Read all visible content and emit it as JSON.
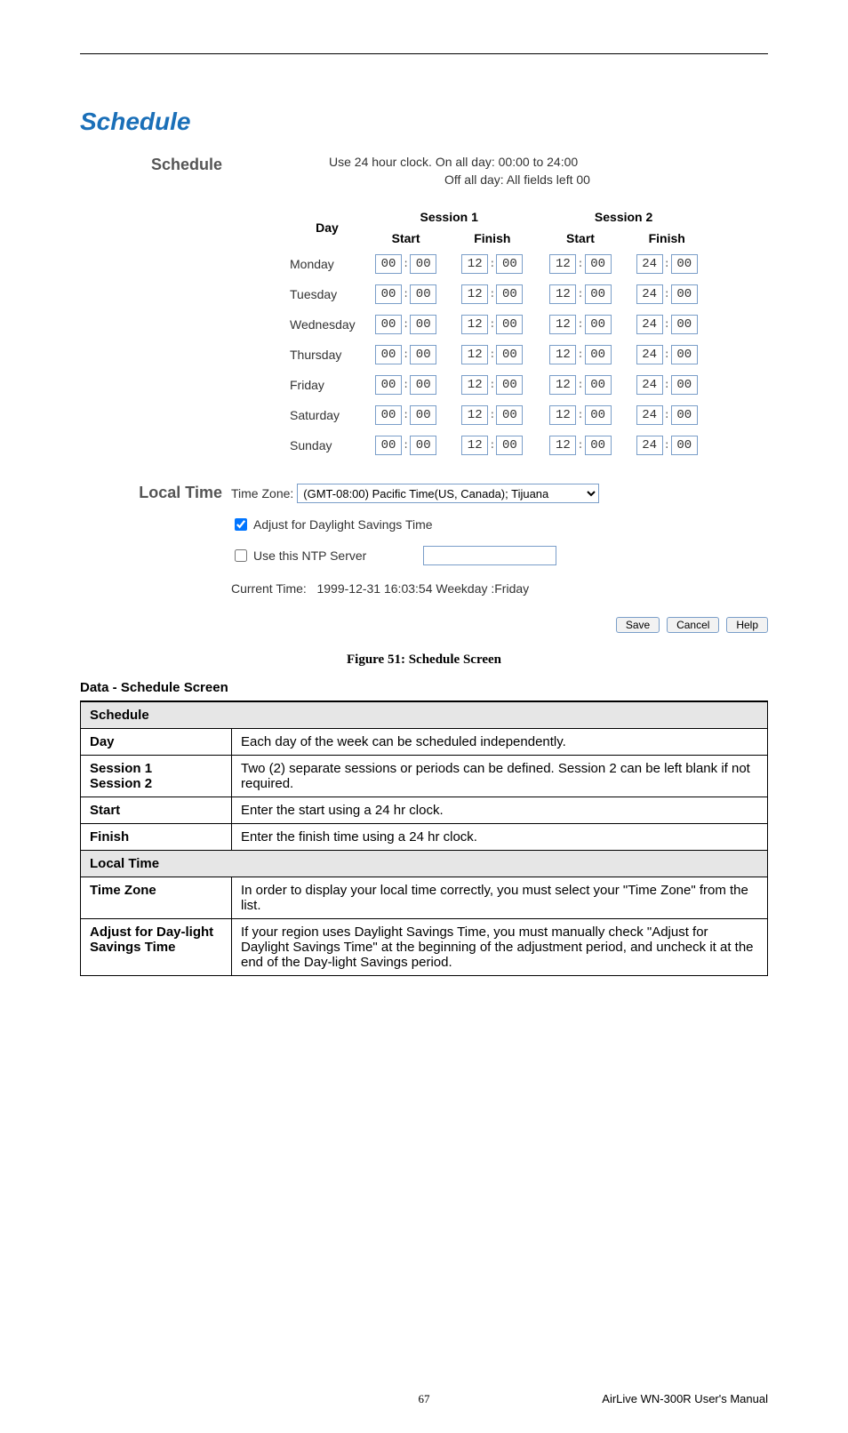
{
  "panel": {
    "title": "Schedule",
    "schedule": {
      "label": "Schedule",
      "hint1": "Use 24 hour clock.   On all day: 00:00 to 24:00",
      "hint2": "Off all day: All fields left 00",
      "headers": {
        "day": "Day",
        "session1": "Session 1",
        "session2": "Session 2",
        "start": "Start",
        "finish": "Finish"
      },
      "days": [
        "Monday",
        "Tuesday",
        "Wednesday",
        "Thursday",
        "Friday",
        "Saturday",
        "Sunday"
      ],
      "defaults": {
        "s1_start_h": "00",
        "s1_start_m": "00",
        "s1_fin_h": "12",
        "s1_fin_m": "00",
        "s2_start_h": "12",
        "s2_start_m": "00",
        "s2_fin_h": "24",
        "s2_fin_m": "00"
      }
    },
    "localtime": {
      "label": "Local Time",
      "tz_label": "Time Zone:",
      "tz_value": "(GMT-08:00) Pacific Time(US, Canada); Tijuana",
      "dst_label": "Adjust for Daylight Savings Time",
      "dst_checked": true,
      "ntp_label": "Use this NTP Server",
      "ntp_checked": false,
      "ntp_value": "",
      "current_label": "Current Time:",
      "current_value": "1999-12-31 16:03:54  Weekday :Friday"
    },
    "buttons": {
      "save": "Save",
      "cancel": "Cancel",
      "help": "Help"
    }
  },
  "figure_caption": "Figure 51: Schedule Screen",
  "data_heading": "Data - Schedule Screen",
  "data_table": {
    "groups": [
      {
        "head": "Schedule",
        "rows": [
          {
            "term": "Day",
            "desc": "Each day of the week can be scheduled independently."
          },
          {
            "term": "Session 1\nSession 2",
            "desc": "Two (2) separate sessions or periods can be defined. Session 2 can be left blank if not required."
          },
          {
            "term": "Start",
            "desc": "Enter the start using a 24 hr clock."
          },
          {
            "term": "Finish",
            "desc": "Enter the finish time using a 24 hr clock."
          }
        ]
      },
      {
        "head": "Local Time",
        "rows": [
          {
            "term": "Time Zone",
            "desc": "In order to display your local time correctly, you must select your \"Time Zone\" from the list."
          },
          {
            "term": "Adjust for Day-light Savings Time",
            "desc": "If your region uses Daylight Savings Time, you must manually check \"Adjust for Daylight Savings Time\" at the beginning of the adjustment period, and uncheck it at the end of the Day-light Savings period."
          }
        ]
      }
    ]
  },
  "footer": {
    "page": "67",
    "manual": "AirLive WN-300R User's Manual"
  }
}
